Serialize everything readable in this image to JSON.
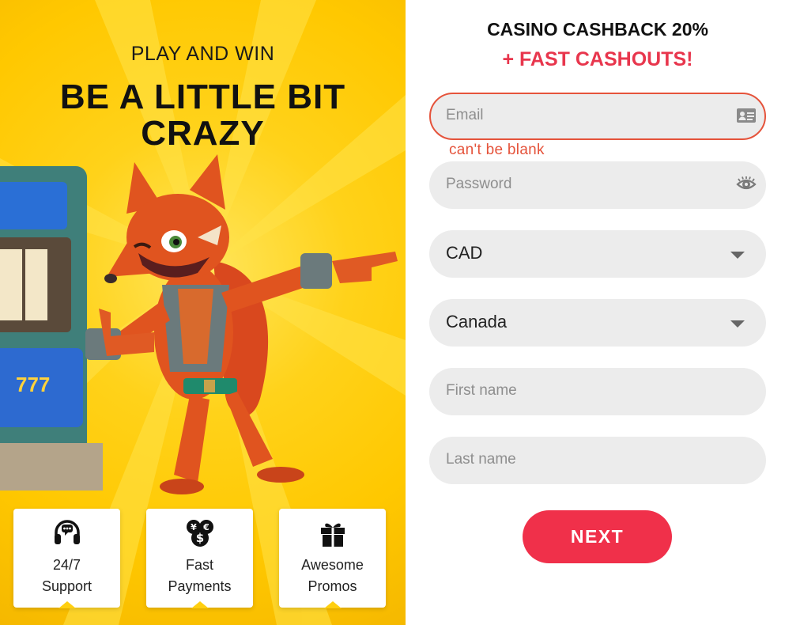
{
  "promo": {
    "subtitle": "PLAY AND WIN",
    "title": "BE A LITTLE BIT CRAZY",
    "features": [
      {
        "icon": "headset-icon",
        "label": "24/7\nSupport"
      },
      {
        "icon": "money-coins-icon",
        "label": "Fast\nPayments"
      },
      {
        "icon": "gift-icon",
        "label": "Awesome\nPromos"
      }
    ]
  },
  "form": {
    "headline_line1": "CASINO CASHBACK 20%",
    "headline_line2": "+ FAST CASHOUTS!",
    "email": {
      "value": "",
      "placeholder": "Email",
      "error": "can't be blank",
      "icon": "id-card-icon"
    },
    "password": {
      "value": "",
      "placeholder": "Password",
      "icon": "eye-icon"
    },
    "currency": {
      "selected": "CAD"
    },
    "country": {
      "selected": "Canada"
    },
    "first_name": {
      "value": "",
      "placeholder": "First name"
    },
    "last_name": {
      "value": "",
      "placeholder": "Last name"
    },
    "next_label": "NEXT"
  },
  "colors": {
    "promo_bg": "#ffc800",
    "accent": "#f0304a",
    "error": "#e5533b",
    "field_bg": "#ececec"
  }
}
